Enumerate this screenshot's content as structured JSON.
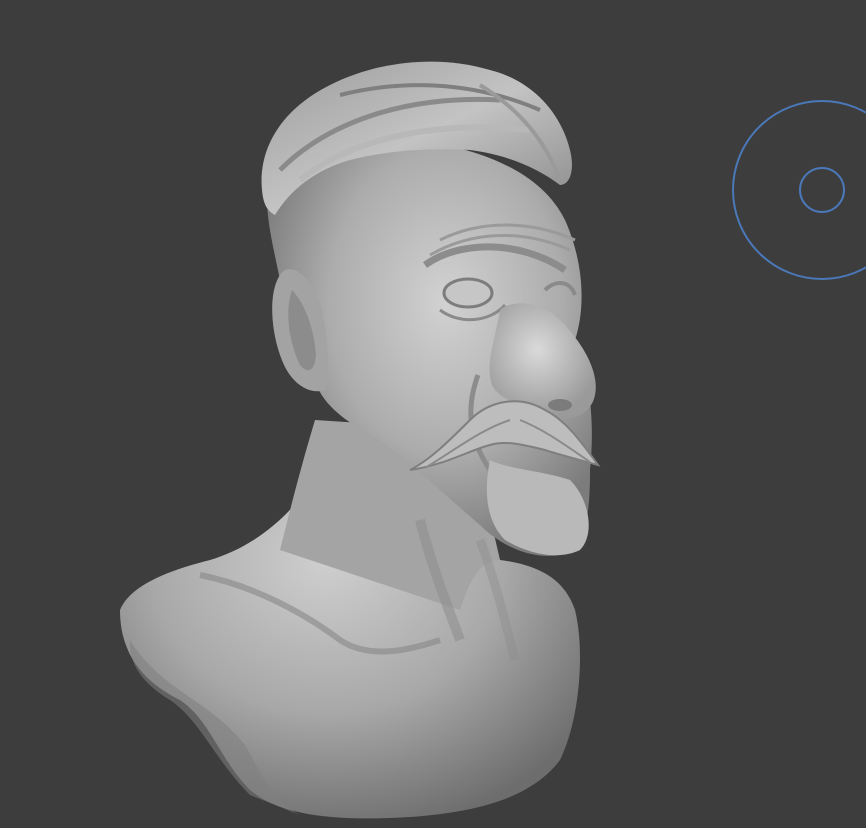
{
  "viewport": {
    "background_color": "#3d3d3d",
    "mode": "sculpt",
    "object": "bust-sculpt"
  },
  "colors": {
    "clay_base": "#a9a9a9",
    "clay_light": "#c9c9c9",
    "clay_shadow": "#7a7a7a",
    "brush_ring": "#4a78b8"
  },
  "icons": {
    "brush_cursor": "brush-cursor-icon"
  }
}
